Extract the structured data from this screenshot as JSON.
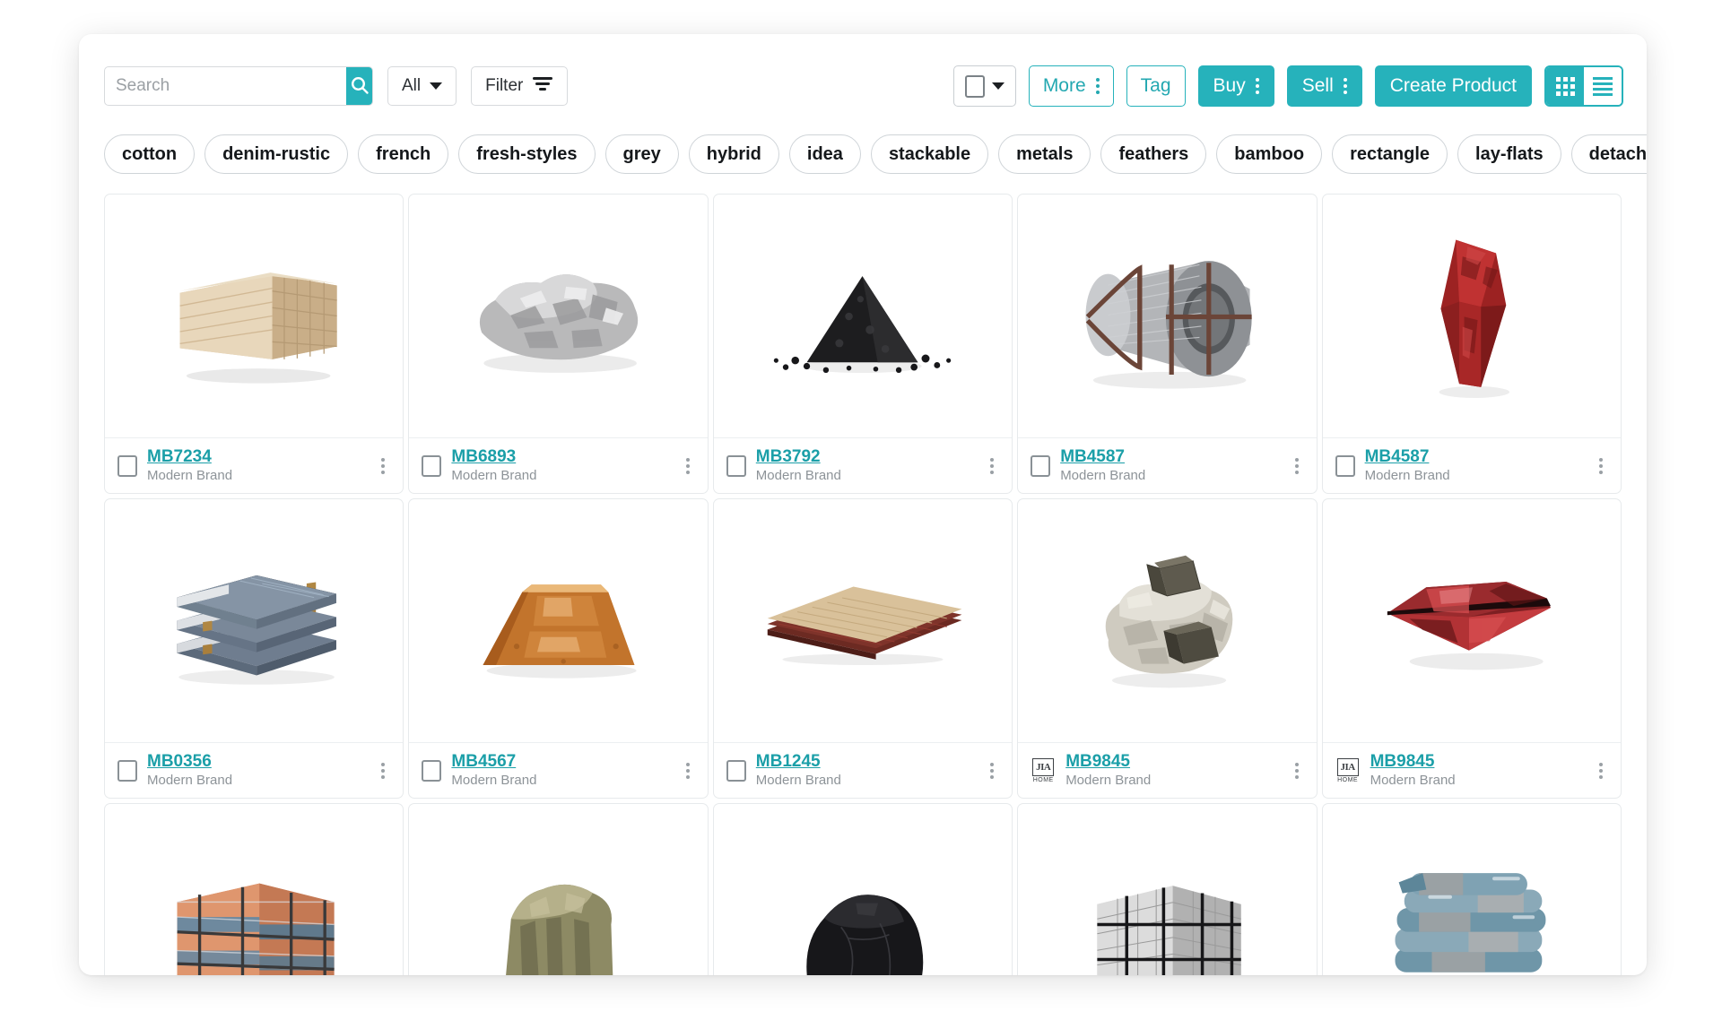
{
  "theme": {
    "accent_teal": "#26b2bb",
    "link_teal": "#1b9fa8",
    "border_grey": "#d7dadd",
    "muted_text": "#8d9398"
  },
  "toolbar": {
    "search": {
      "placeholder": "Search",
      "value": "",
      "icon": "search-icon",
      "button_label": ""
    },
    "scope_dropdown": {
      "label": "All",
      "icon": "chevron-down-icon"
    },
    "filter_button": {
      "label": "Filter",
      "icon": "filter-icon"
    },
    "bulk_select": {
      "label": "",
      "icon": "checkbox-dropdown-icon"
    },
    "more_button": {
      "label": "More",
      "icon": "kebab-icon"
    },
    "tag_button": {
      "label": "Tag"
    },
    "buy_button": {
      "label": "Buy",
      "icon": "kebab-icon"
    },
    "sell_button": {
      "label": "Sell",
      "icon": "kebab-icon"
    },
    "create_product_button": {
      "label": "Create Product"
    },
    "view_toggle": {
      "grid_label": "",
      "list_label": "",
      "active": "grid"
    }
  },
  "tags": [
    {
      "label": "cotton"
    },
    {
      "label": "denim-rustic"
    },
    {
      "label": "french"
    },
    {
      "label": "fresh-styles"
    },
    {
      "label": "grey"
    },
    {
      "label": "hybrid"
    },
    {
      "label": "idea"
    },
    {
      "label": "stackable"
    },
    {
      "label": "metals"
    },
    {
      "label": "feathers"
    },
    {
      "label": "bamboo"
    },
    {
      "label": "rectangle"
    },
    {
      "label": "lay-flats"
    },
    {
      "label": "detached"
    }
  ],
  "brand_badge": {
    "mark": "JIA",
    "sub": "HOME"
  },
  "products": [
    {
      "sku": "MB7234",
      "brand": "Modern Brand",
      "image": "timber-stack-image",
      "selector": "checkbox"
    },
    {
      "sku": "MB6893",
      "brand": "Modern Brand",
      "image": "ore-nugget-image",
      "selector": "checkbox"
    },
    {
      "sku": "MB3792",
      "brand": "Modern Brand",
      "image": "black-granules-image",
      "selector": "checkbox"
    },
    {
      "sku": "MB4587",
      "brand": "Modern Brand",
      "image": "steel-coil-image",
      "selector": "checkbox"
    },
    {
      "sku": "MB4587",
      "brand": "Modern Brand",
      "image": "red-jasper-image",
      "selector": "checkbox"
    },
    {
      "sku": "MB0356",
      "brand": "Modern Brand",
      "image": "slab-stack-image",
      "selector": "checkbox"
    },
    {
      "sku": "MB4567",
      "brand": "Modern Brand",
      "image": "copper-ingot-image",
      "selector": "checkbox"
    },
    {
      "sku": "MB1245",
      "brand": "Modern Brand",
      "image": "timber-bundle-image",
      "selector": "checkbox"
    },
    {
      "sku": "MB9845",
      "brand": "Modern Brand",
      "image": "pyrite-rock-image",
      "selector": "brand-badge"
    },
    {
      "sku": "MB9845",
      "brand": "Modern Brand",
      "image": "ruby-gem-image",
      "selector": "brand-badge"
    },
    {
      "sku": "",
      "brand": "",
      "image": "cement-pallet-image",
      "selector": "none"
    },
    {
      "sku": "",
      "brand": "",
      "image": "stone-chunk-image",
      "selector": "none"
    },
    {
      "sku": "",
      "brand": "",
      "image": "coal-lump-image",
      "selector": "none"
    },
    {
      "sku": "",
      "brand": "",
      "image": "block-stack-image",
      "selector": "none"
    },
    {
      "sku": "",
      "brand": "",
      "image": "cement-bags-image",
      "selector": "none"
    }
  ]
}
